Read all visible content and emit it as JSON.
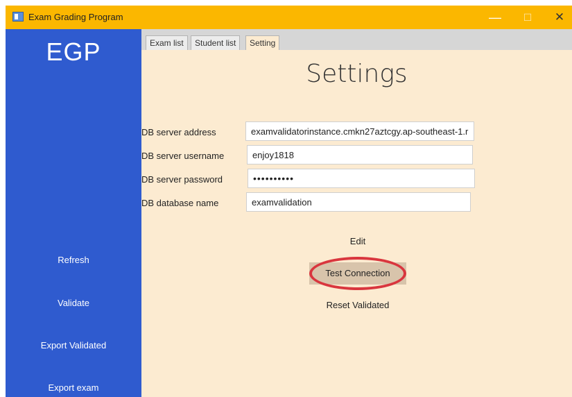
{
  "window": {
    "title": "Exam Grading Program",
    "minimize_glyph": "—",
    "maximize_glyph": "☐",
    "close_glyph": "✕"
  },
  "sidebar": {
    "logo": "EGP",
    "buttons": [
      {
        "label": "Refresh"
      },
      {
        "label": "Validate"
      },
      {
        "label": "Export Validated"
      },
      {
        "label": "Export exam"
      }
    ]
  },
  "tabs": [
    {
      "label": "Exam list",
      "active": false
    },
    {
      "label": "Student list",
      "active": false
    },
    {
      "label": "Setting",
      "active": true
    }
  ],
  "settings": {
    "title": "Settings",
    "fields": [
      {
        "label": "DB server address",
        "value": "examvalidatorinstance.cmkn27aztcgy.ap-southeast-1.r"
      },
      {
        "label": "DB server username",
        "value": "enjoy1818"
      },
      {
        "label": "DB server password",
        "value": "••••••••••"
      },
      {
        "label": "DB database name",
        "value": "examvalidation"
      }
    ],
    "actions": {
      "edit": "Edit",
      "test_connection": "Test Connection",
      "reset_validated": "Reset Validated"
    }
  },
  "colors": {
    "titlebar": "#fbb700",
    "sidebar": "#2f5bcf",
    "content_bg": "#fcebd1",
    "highlight": "#d9363e"
  }
}
